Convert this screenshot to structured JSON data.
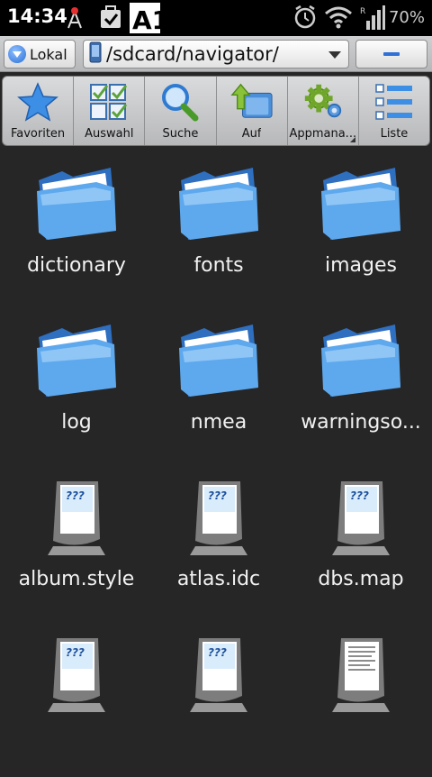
{
  "statusbar": {
    "time": "14:34",
    "carrier_logo": "A1",
    "battery_text": "70%",
    "signal_label": "R",
    "icons": [
      "antenna-icon",
      "download-check-icon",
      "a1-icon",
      "alarm-icon",
      "wifi-icon",
      "signal-icon"
    ]
  },
  "pathbar": {
    "lokal_label": "Lokal",
    "path": "/sdcard/navigator/"
  },
  "toolbar": {
    "items": [
      {
        "label": "Favoriten",
        "icon": "star-icon"
      },
      {
        "label": "Auswahl",
        "icon": "checklist-icon"
      },
      {
        "label": "Suche",
        "icon": "magnifier-icon"
      },
      {
        "label": "Auf",
        "icon": "up-folder-icon"
      },
      {
        "label": "Appmana...",
        "icon": "gears-icon"
      },
      {
        "label": "Liste",
        "icon": "list-icon"
      }
    ]
  },
  "files": [
    {
      "name": "dictionary",
      "type": "folder"
    },
    {
      "name": "fonts",
      "type": "folder"
    },
    {
      "name": "images",
      "type": "folder"
    },
    {
      "name": "log",
      "type": "folder"
    },
    {
      "name": "nmea",
      "type": "folder"
    },
    {
      "name": "warningso...",
      "type": "folder"
    },
    {
      "name": "album.style",
      "type": "unknown"
    },
    {
      "name": "atlas.idc",
      "type": "unknown"
    },
    {
      "name": "dbs.map",
      "type": "unknown"
    },
    {
      "name": "",
      "type": "unknown"
    },
    {
      "name": "",
      "type": "unknown"
    },
    {
      "name": "",
      "type": "text"
    }
  ],
  "colors": {
    "background": "#262626",
    "folder_blue": "#4a9be6",
    "accent": "#2f6fd8"
  }
}
